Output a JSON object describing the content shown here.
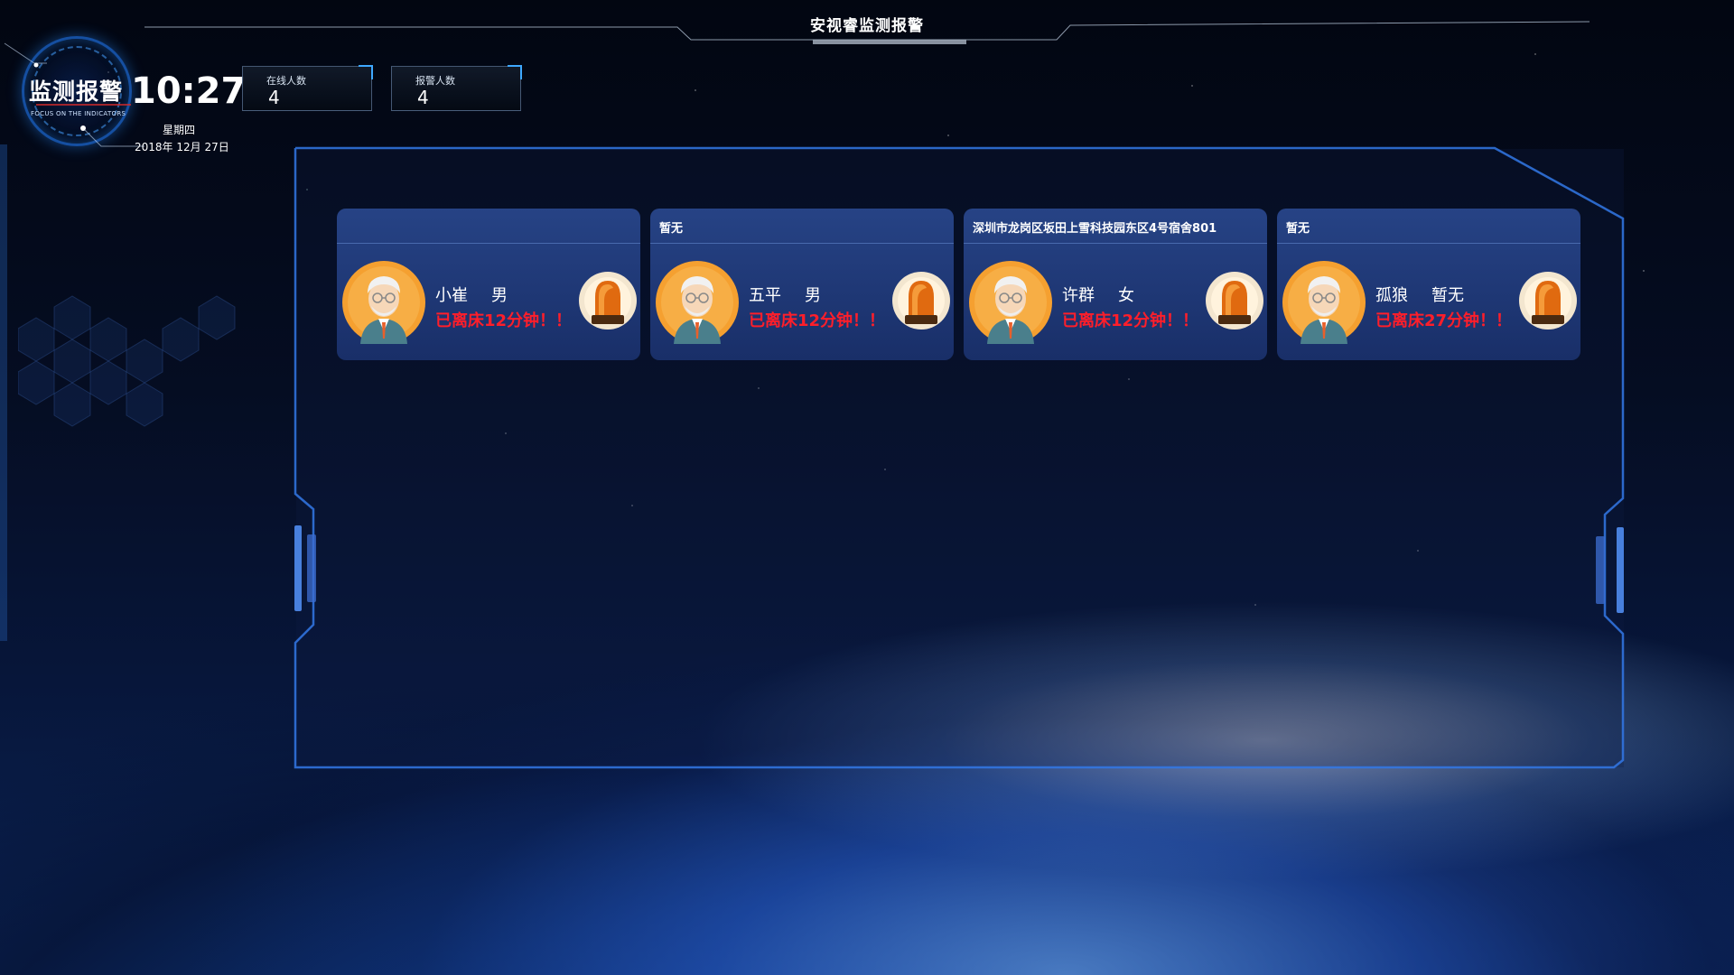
{
  "header": {
    "title": "安视睿监测报警"
  },
  "logo": {
    "title": "监测报警",
    "subtitle": "FOCUS ON THE INDICATORS"
  },
  "clock": {
    "time": "10:27",
    "weekday": "星期四",
    "date": "2018年 12月 27日"
  },
  "stats": [
    {
      "label": "在线人数",
      "value": "4"
    },
    {
      "label": "报警人数",
      "value": "4"
    }
  ],
  "cards": [
    {
      "address": "",
      "name": "小崔",
      "gender": "男",
      "alarm": "已离床12分钟！！"
    },
    {
      "address": "暂无",
      "name": "五平",
      "gender": "男",
      "alarm": "已离床12分钟！！"
    },
    {
      "address": "深圳市龙岗区坂田上雪科技园东区4号宿舍801",
      "name": "许群",
      "gender": "女",
      "alarm": "已离床12分钟！！"
    },
    {
      "address": "暂无",
      "name": "孤狼",
      "gender": "暂无",
      "alarm": "已离床27分钟！！"
    }
  ],
  "colors": {
    "alarm": "#ff1e2a",
    "accent": "#3ea8ff",
    "card": "#2c4c96"
  }
}
